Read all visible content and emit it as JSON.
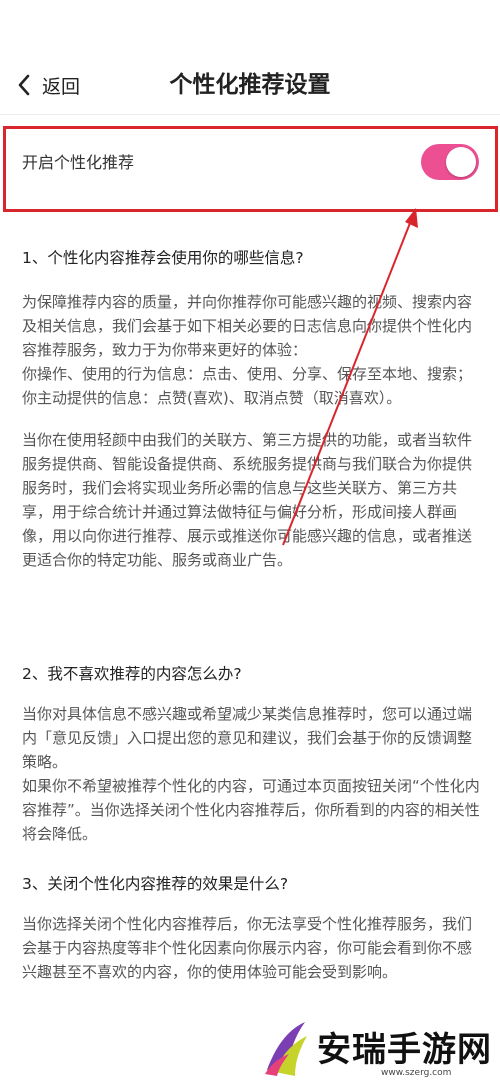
{
  "header": {
    "back_label": "返回",
    "title": "个性化推荐设置"
  },
  "toggle": {
    "label": "开启个性化推荐",
    "state": "on",
    "color": "#ec4f92"
  },
  "annotation": {
    "box_color": "#d9262c"
  },
  "sections": [
    {
      "heading": "1、个性化内容推荐会使用你的哪些信息?",
      "paragraphs": [
        "为保障推荐内容的质量，并向你推荐你可能感兴趣的视频、搜索内容及相关信息，我们会基于如下相关必要的日志信息向你提供个性化内容推荐服务，致力于为你带来更好的体验：",
        "你操作、使用的行为信息：点击、使用、分享、保存至本地、搜索；",
        "你主动提供的信息：点赞(喜欢)、取消点赞（取消喜欢）。",
        "当你在使用轻颜中由我们的关联方、第三方提供的功能，或者当软件服务提供商、智能设备提供商、系统服务提供商与我们联合为你提供服务时，我们会将实现业务所必需的信息与这些关联方、第三方共享，用于综合统计并通过算法做特征与偏好分析，形成间接人群画像，用以向你进行推荐、展示或推送你可能感兴趣的信息，或者推送更适合你的特定功能、服务或商业广告。"
      ]
    },
    {
      "heading": "2、我不喜欢推荐的内容怎么办?",
      "paragraphs": [
        "当你对具体信息不感兴趣或希望减少某类信息推荐时，您可以通过端内「意见反馈」入口提出您的意见和建议，我们会基于你的反馈调整策略。",
        "如果你不希望被推荐个性化的内容，可通过本页面按钮关闭“个性化内容推荐”。当你选择关闭个性化内容推荐后，你所看到的内容的相关性将会降低。"
      ]
    },
    {
      "heading": "3、关闭个性化内容推荐的效果是什么?",
      "paragraphs": [
        "当你选择关闭个性化内容推荐后，你无法享受个性化推荐服务，我们会基于内容热度等非个性化因素向你展示内容，你可能会看到你不感兴趣甚至不喜欢的内容，你的使用体验可能会受到影响。"
      ]
    }
  ],
  "watermark": {
    "text": "安瑞手游网",
    "url": "www.szerg.com"
  }
}
